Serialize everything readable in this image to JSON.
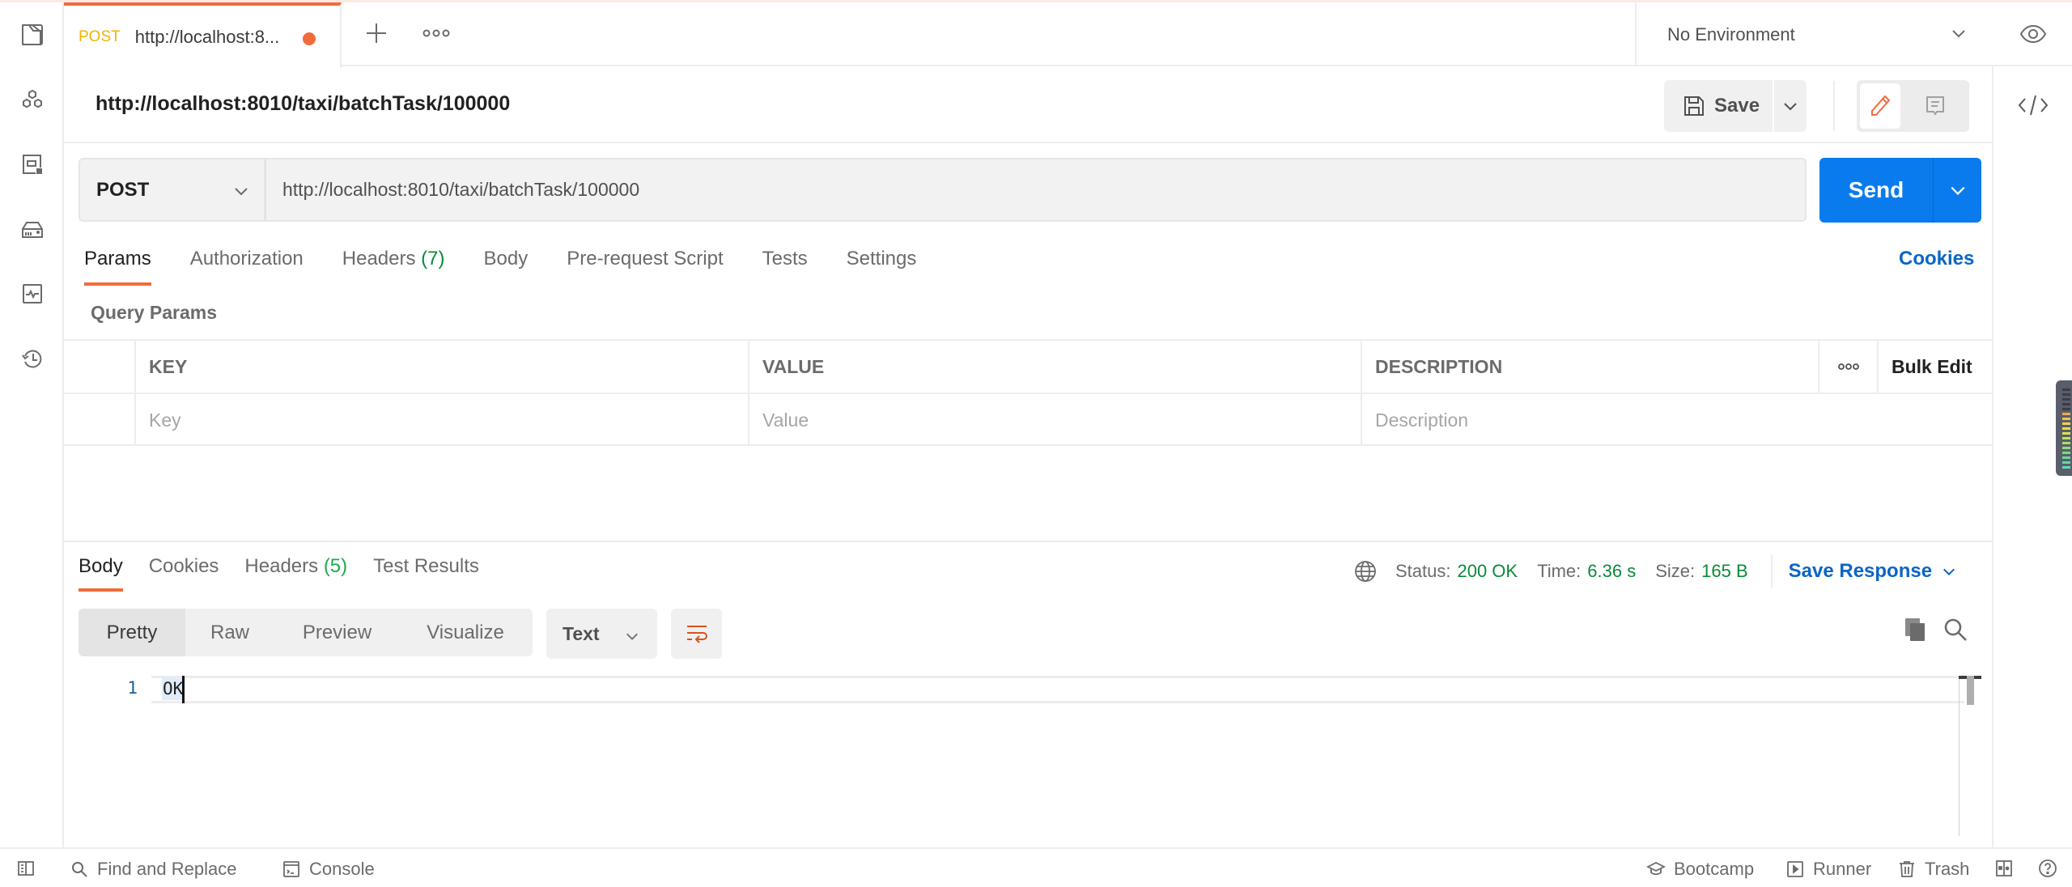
{
  "sidebar": {
    "icons": [
      "collections-icon",
      "apis-icon",
      "mock-servers-icon",
      "environments-icon",
      "monitors-icon",
      "history-icon"
    ]
  },
  "tabs": {
    "active": {
      "method": "POST",
      "title": "http://localhost:8...",
      "unsaved": true
    },
    "new_tab_label": "+",
    "more_label": "ooo"
  },
  "environment": {
    "selected": "No Environment"
  },
  "request": {
    "name": "http://localhost:8010/taxi/batchTask/100000",
    "method": "POST",
    "url": "http://localhost:8010/taxi/batchTask/100000",
    "save_label": "Save",
    "send_label": "Send",
    "cookies_label": "Cookies",
    "tabs": [
      {
        "label": "Params",
        "count": "",
        "active": true
      },
      {
        "label": "Authorization",
        "count": "",
        "active": false
      },
      {
        "label": "Headers",
        "count": "(7)",
        "active": false
      },
      {
        "label": "Body",
        "count": "",
        "active": false
      },
      {
        "label": "Pre-request Script",
        "count": "",
        "active": false
      },
      {
        "label": "Tests",
        "count": "",
        "active": false
      },
      {
        "label": "Settings",
        "count": "",
        "active": false
      }
    ],
    "query_params": {
      "title": "Query Params",
      "columns": {
        "key": "KEY",
        "value": "VALUE",
        "description": "DESCRIPTION",
        "more": "ooo",
        "bulk_edit": "Bulk Edit"
      },
      "placeholders": {
        "key": "Key",
        "value": "Value",
        "description": "Description"
      },
      "rows": []
    }
  },
  "response": {
    "tabs": [
      {
        "label": "Body",
        "count": "",
        "active": true
      },
      {
        "label": "Cookies",
        "count": "",
        "active": false
      },
      {
        "label": "Headers",
        "count": "(5)",
        "active": false
      },
      {
        "label": "Test Results",
        "count": "",
        "active": false
      }
    ],
    "status_label": "Status:",
    "status": "200 OK",
    "time_label": "Time:",
    "time": "6.36 s",
    "size_label": "Size:",
    "size": "165 B",
    "save_response_label": "Save Response",
    "view_modes": [
      "Pretty",
      "Raw",
      "Preview",
      "Visualize"
    ],
    "active_view": "Pretty",
    "format": "Text",
    "body_lines": [
      {
        "num": "1",
        "text": "OK"
      }
    ]
  },
  "statusbar": {
    "find_replace": "Find and Replace",
    "console": "Console",
    "bootcamp": "Bootcamp",
    "runner": "Runner",
    "trash": "Trash"
  },
  "colors": {
    "accent": "#f26b3a",
    "send_blue": "#097bed",
    "link_blue": "#0b65c6",
    "success_green": "#0a8a3a",
    "method_post": "#f0b400"
  }
}
